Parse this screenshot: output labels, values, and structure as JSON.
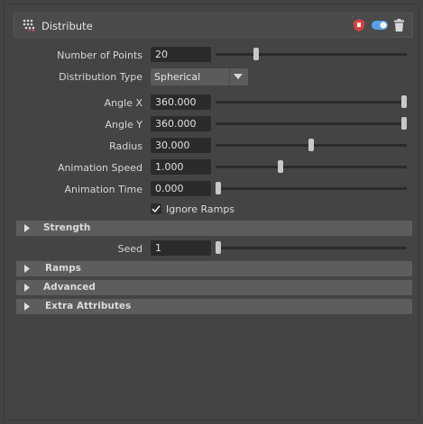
{
  "header": {
    "title": "Distribute",
    "icons": [
      "distribute-node-icon",
      "shield-icon",
      "toggle-icon",
      "trash-icon"
    ]
  },
  "params": {
    "num_points": {
      "label": "Number of Points",
      "value": "20",
      "slider_fraction": 0.21
    },
    "distribution_type": {
      "label": "Distribution Type",
      "value": "Spherical"
    },
    "angle_x": {
      "label": "Angle X",
      "value": "360.000",
      "slider_fraction": 1.0
    },
    "angle_y": {
      "label": "Angle Y",
      "value": "360.000",
      "slider_fraction": 1.0
    },
    "radius": {
      "label": "Radius",
      "value": "30.000",
      "slider_fraction": 0.5
    },
    "animation_speed": {
      "label": "Animation Speed",
      "value": "1.000",
      "slider_fraction": 0.34
    },
    "animation_time": {
      "label": "Animation Time",
      "value": "0.000",
      "slider_fraction": 0.0
    },
    "ignore_ramps": {
      "label": "Ignore Ramps",
      "checked": true
    },
    "seed": {
      "label": "Seed",
      "value": "1",
      "slider_fraction": 0.0
    }
  },
  "sections": {
    "strength": "Strength",
    "ramps": "Ramps",
    "advanced": "Advanced",
    "extra": "Extra Attributes"
  },
  "colors": {
    "background": "#444444",
    "field": "#2b2b2b",
    "section_bar": "#5d5d5d",
    "accent_blue": "#5aa0e6",
    "shield_red": "#d94040"
  }
}
